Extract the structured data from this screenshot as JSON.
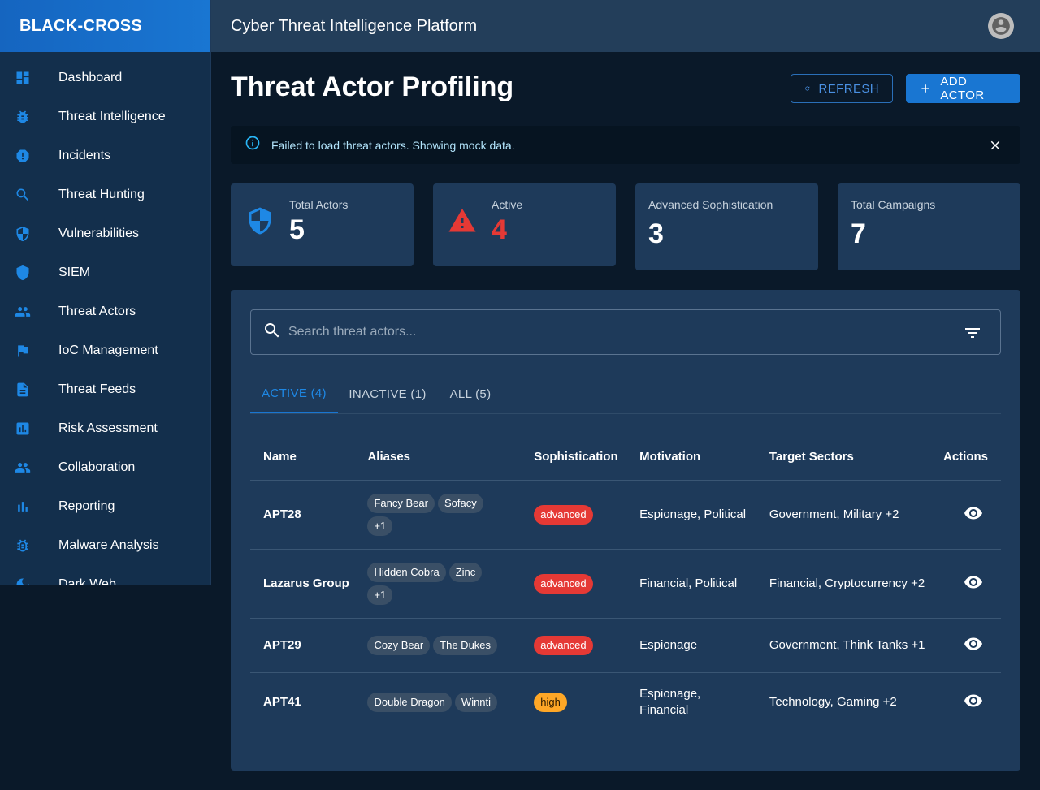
{
  "brand": "BLACK-CROSS",
  "topbar": {
    "title": "Cyber Threat Intelligence Platform"
  },
  "sidebar": {
    "items": [
      {
        "label": "Dashboard",
        "icon": "dashboard-icon"
      },
      {
        "label": "Threat Intelligence",
        "icon": "bug-icon"
      },
      {
        "label": "Incidents",
        "icon": "report-icon"
      },
      {
        "label": "Threat Hunting",
        "icon": "search-icon"
      },
      {
        "label": "Vulnerabilities",
        "icon": "shield-half-icon"
      },
      {
        "label": "SIEM",
        "icon": "shield-icon"
      },
      {
        "label": "Threat Actors",
        "icon": "people-icon"
      },
      {
        "label": "IoC Management",
        "icon": "flag-icon"
      },
      {
        "label": "Threat Feeds",
        "icon": "document-icon"
      },
      {
        "label": "Risk Assessment",
        "icon": "assessment-icon"
      },
      {
        "label": "Collaboration",
        "icon": "group-icon"
      },
      {
        "label": "Reporting",
        "icon": "bar-chart-icon"
      },
      {
        "label": "Malware Analysis",
        "icon": "bug-outline-icon"
      },
      {
        "label": "Dark Web",
        "icon": "moon-icon"
      }
    ]
  },
  "page": {
    "title": "Threat Actor Profiling",
    "refresh_label": "REFRESH",
    "add_label": "ADD ACTOR"
  },
  "alert": {
    "message": "Failed to load threat actors. Showing mock data."
  },
  "stats": {
    "total_actors": {
      "label": "Total Actors",
      "value": "5"
    },
    "active": {
      "label": "Active",
      "value": "4"
    },
    "advanced": {
      "label": "Advanced Sophistication",
      "value": "3"
    },
    "campaigns": {
      "label": "Total Campaigns",
      "value": "7"
    }
  },
  "search": {
    "placeholder": "Search threat actors..."
  },
  "tabs": [
    {
      "label": "ACTIVE (4)",
      "active": true
    },
    {
      "label": "INACTIVE (1)",
      "active": false
    },
    {
      "label": "ALL (5)",
      "active": false
    }
  ],
  "table": {
    "headers": [
      "Name",
      "Aliases",
      "Sophistication",
      "Motivation",
      "Target Sectors",
      "Actions"
    ],
    "rows": [
      {
        "name": "APT28",
        "aliases": [
          "Fancy Bear",
          "Sofacy",
          "+1"
        ],
        "sophistication": "advanced",
        "motivation": "Espionage, Political",
        "targets": "Government, Military +2"
      },
      {
        "name": "Lazarus Group",
        "aliases": [
          "Hidden Cobra",
          "Zinc",
          "+1"
        ],
        "sophistication": "advanced",
        "motivation": "Financial, Political",
        "targets": "Financial, Cryptocurrency +2"
      },
      {
        "name": "APT29",
        "aliases": [
          "Cozy Bear",
          "The Dukes"
        ],
        "sophistication": "advanced",
        "motivation": "Espionage",
        "targets": "Government, Think Tanks +1"
      },
      {
        "name": "APT41",
        "aliases": [
          "Double Dragon",
          "Winnti"
        ],
        "sophistication": "high",
        "motivation": "Espionage, Financial",
        "targets": "Technology, Gaming +2"
      }
    ]
  },
  "colors": {
    "accent": "#1976d2",
    "danger": "#e53935",
    "warning": "#ffa726",
    "panel": "#1e3a5a",
    "background": "#0a1929"
  }
}
